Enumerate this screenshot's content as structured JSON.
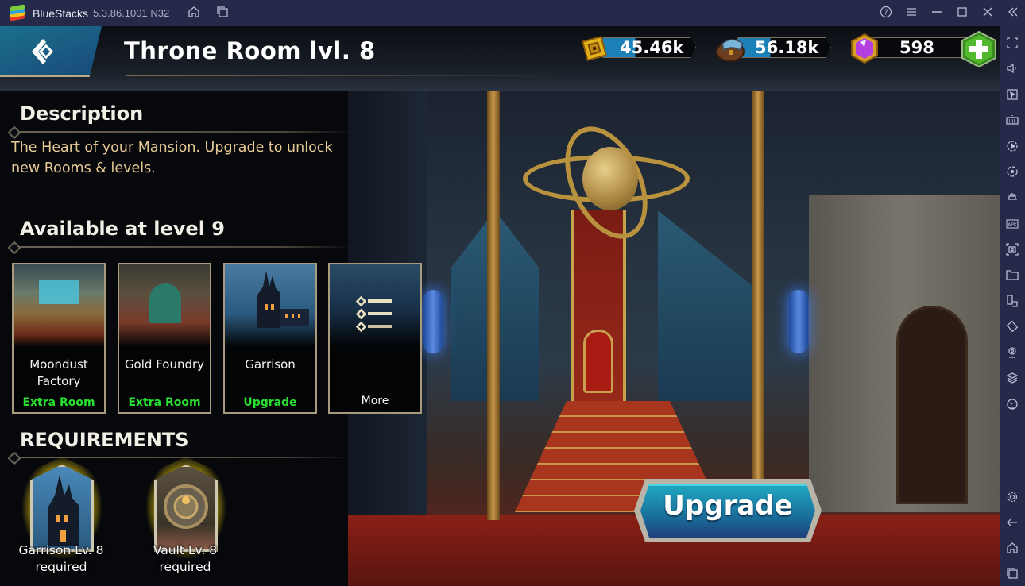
{
  "titlebar": {
    "app_name": "BlueStacks",
    "version": "5.3.86.1001 N32",
    "icons": [
      "home-icon",
      "multi-instance-icon"
    ],
    "right_icons": [
      "help-icon",
      "menu-icon",
      "minimize-icon",
      "maximize-icon",
      "close-icon",
      "collapse-sidebar-icon"
    ]
  },
  "sidebar": {
    "top_icons": [
      "fullscreen-icon",
      "volume-icon",
      "pointer-icon",
      "keyboard-icon",
      "macro-play-icon",
      "rotate-sync-icon",
      "gamepad-icon",
      "apk-install-icon",
      "screenshot-icon",
      "folder-icon",
      "multi-window-icon",
      "shake-icon",
      "location-icon",
      "layers-icon",
      "performance-icon"
    ],
    "bottom_icons": [
      "settings-icon",
      "back-icon",
      "home-icon",
      "recent-apps-icon"
    ]
  },
  "header": {
    "title": "Throne Room lvl. 8",
    "resources": [
      {
        "name": "gold",
        "value": "45.46k",
        "icon": "gold-icon"
      },
      {
        "name": "moondust",
        "value": "56.18k",
        "icon": "moondust-bag-icon"
      },
      {
        "name": "gems",
        "value": "598",
        "icon": "gem-icon"
      }
    ],
    "add_currency_icon": "plus-icon"
  },
  "description": {
    "heading": "Description",
    "text": "The Heart of your Mansion. Upgrade to unlock new Rooms & levels."
  },
  "available": {
    "heading": "Available at level 9",
    "cards": [
      {
        "name": "Moondust Factory",
        "tag": "Extra Room"
      },
      {
        "name": "Gold Foundry",
        "tag": "Extra Room"
      },
      {
        "name": "Garrison",
        "tag": "Upgrade"
      },
      {
        "name": "",
        "more_label": "More"
      }
    ]
  },
  "requirements": {
    "heading": "REQUIREMENTS",
    "items": [
      {
        "label": "Garrison Lv. 8 required"
      },
      {
        "label": "Vault Lv. 8 required"
      }
    ]
  },
  "actions": {
    "upgrade_label": "Upgrade"
  },
  "colors": {
    "accent_teal": "#1a8fb4",
    "tag_green": "#28e030",
    "description_gold": "#e7c995",
    "chrome_navy": "#262a4a",
    "glow_yellow": "#e8c80a"
  }
}
